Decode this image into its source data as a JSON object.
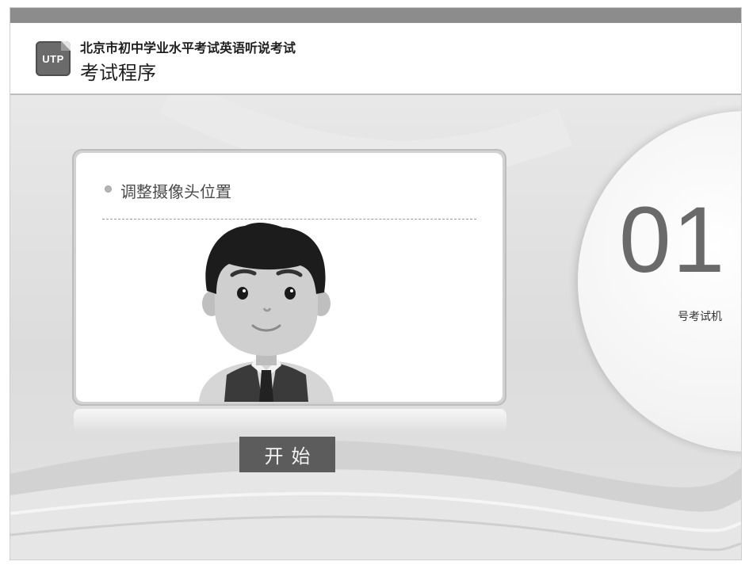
{
  "header": {
    "logo_text": "UTP",
    "exam_title": "北京市初中学业水平考试英语听说考试",
    "page_title": "考试程序"
  },
  "step": {
    "title": "调整摄像头位置",
    "avatar_icon": "student-avatar-icon"
  },
  "start_button": {
    "label": "开始"
  },
  "seat": {
    "number": "01",
    "label": "号考试机"
  },
  "colors": {
    "header_strip": "#8c8c8c",
    "button_bg": "#5c5c5c",
    "seat_number": "#6a6a6a"
  }
}
